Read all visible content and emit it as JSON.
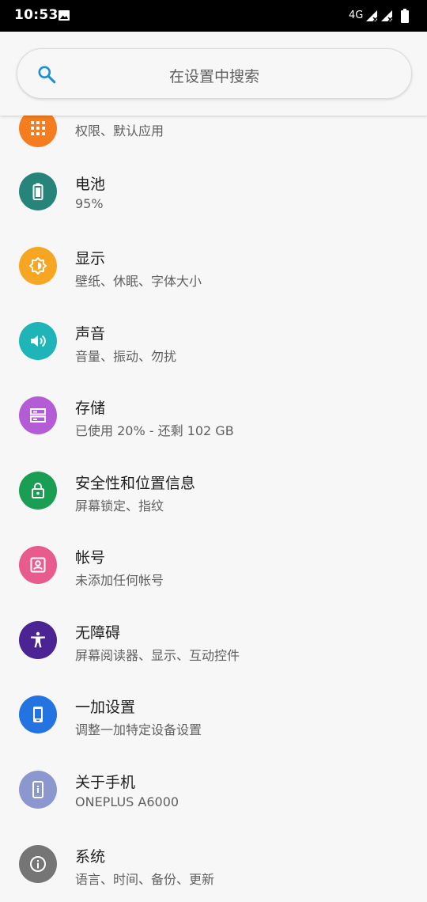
{
  "status_bar": {
    "time": "10:53",
    "network_type": "4G",
    "icons": [
      "image-notification-icon",
      "signal-icon",
      "signal-icon",
      "battery-icon"
    ]
  },
  "search": {
    "placeholder": "在设置中搜索"
  },
  "items": [
    {
      "title": "",
      "subtitle": "权限、默认应用",
      "color": "#f57c1f",
      "icon": "apps-icon"
    },
    {
      "title": "电池",
      "subtitle": "95%",
      "color": "#27847a",
      "icon": "battery-icon"
    },
    {
      "title": "显示",
      "subtitle": "壁纸、休眠、字体大小",
      "color": "#f6a623",
      "icon": "brightness-icon"
    },
    {
      "title": "声音",
      "subtitle": "音量、振动、勿扰",
      "color": "#1fb5b8",
      "icon": "volume-icon"
    },
    {
      "title": "存储",
      "subtitle": "已使用 20% - 还剩 102 GB",
      "color": "#b45cd6",
      "icon": "storage-icon"
    },
    {
      "title": "安全性和位置信息",
      "subtitle": "屏幕锁定、指纹",
      "color": "#1a9e53",
      "icon": "lock-icon"
    },
    {
      "title": "帐号",
      "subtitle": "未添加任何帐号",
      "color": "#e75c8c",
      "icon": "account-icon"
    },
    {
      "title": "无障碍",
      "subtitle": "屏幕阅读器、显示、互动控件",
      "color": "#4b2393",
      "icon": "accessibility-icon"
    },
    {
      "title": "一加设置",
      "subtitle": "调整一加特定设备设置",
      "color": "#2374e1",
      "icon": "device-icon"
    },
    {
      "title": "关于手机",
      "subtitle": "ONEPLUS A6000",
      "color": "#8b97ce",
      "icon": "phone-info-icon"
    },
    {
      "title": "系统",
      "subtitle": "语言、时间、备份、更新",
      "color": "#757575",
      "icon": "info-icon"
    }
  ]
}
